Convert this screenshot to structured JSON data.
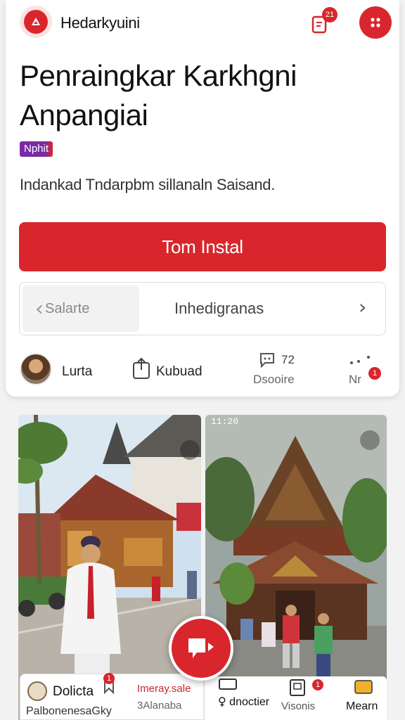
{
  "header": {
    "app_name": "Hedarkyuini",
    "notification_count": "21",
    "logo_icon": "app-logo-icon",
    "menu_icon": "dots-grid-icon"
  },
  "hero": {
    "title_line1": "Penraingkar Karkhgni",
    "title_line2": "Anpangiai",
    "tag": "Nphit",
    "subtitle": "Indankad Tndarpbm sillanaln Saisand.",
    "install_label": "Tom Instal"
  },
  "search": {
    "select_label": "Salarte",
    "placeholder": "Inhedigranas",
    "arrow": "›"
  },
  "actions": {
    "user_label": "Lurta",
    "share_label": "Kubuad",
    "comments_count": "72",
    "comments_label": "Dsooire",
    "more_label": "Nr",
    "more_badge": "1"
  },
  "feed": {
    "status_time": "11:20",
    "left_title": "Dolicta",
    "left_sub": "Palbonenesa",
    "left_sub2": "Gky",
    "left_badge": "1",
    "left_meta": "Imeray.sale",
    "left_meta2": "3Alanaba",
    "right_item1": "dnoctier",
    "right_item2": "Visonis",
    "right_item3": "Mearn",
    "right_badge": "1"
  },
  "colors": {
    "accent": "#d9262c",
    "tag_purple": "#7a2aa6"
  }
}
